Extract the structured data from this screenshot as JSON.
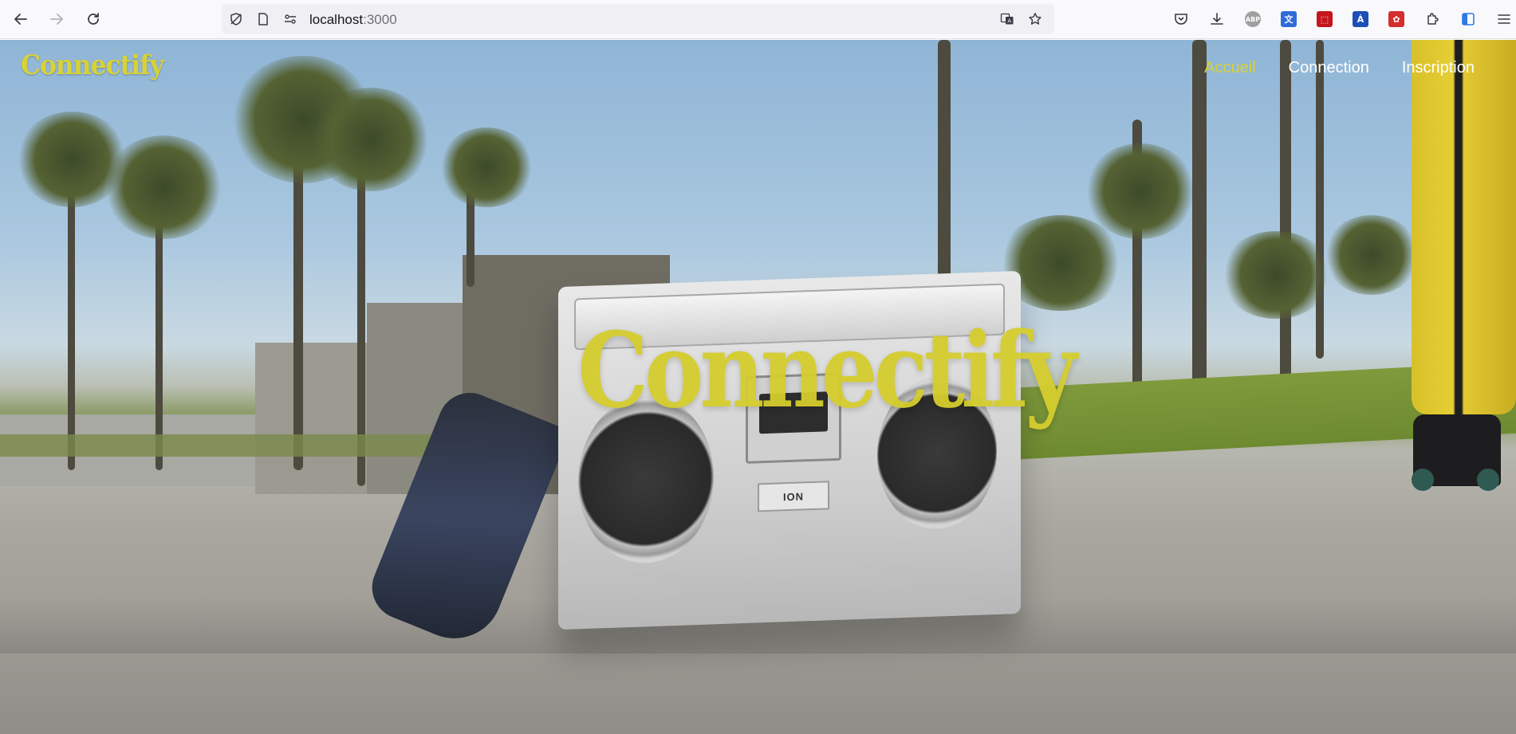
{
  "browser": {
    "url_host": "localhost",
    "url_port": ":3000",
    "extensions": [
      {
        "name": "pocket-icon"
      },
      {
        "name": "downloads-icon"
      },
      {
        "name": "adblock-icon",
        "label": "ABP",
        "color": "#9a9a9a"
      },
      {
        "name": "translate-extension-icon",
        "color": "#2f6cd9"
      },
      {
        "name": "pdf-extension-icon",
        "color": "#c4161c"
      },
      {
        "name": "text-extension-icon",
        "label": "A",
        "color": "#1c4fb8"
      },
      {
        "name": "red-extension-icon",
        "color": "#d42e2e"
      },
      {
        "name": "extensions-puzzle-icon"
      },
      {
        "name": "sidebar-icon",
        "color": "#2f7be6"
      }
    ]
  },
  "site": {
    "logo": "Connectify",
    "nav": {
      "home": "Accueil",
      "login": "Connection",
      "signup": "Inscription"
    },
    "hero_title": "Connectify",
    "boombox_brand": "ION"
  },
  "colors": {
    "accent": "#d8d236",
    "nav_text": "#ffffff"
  }
}
